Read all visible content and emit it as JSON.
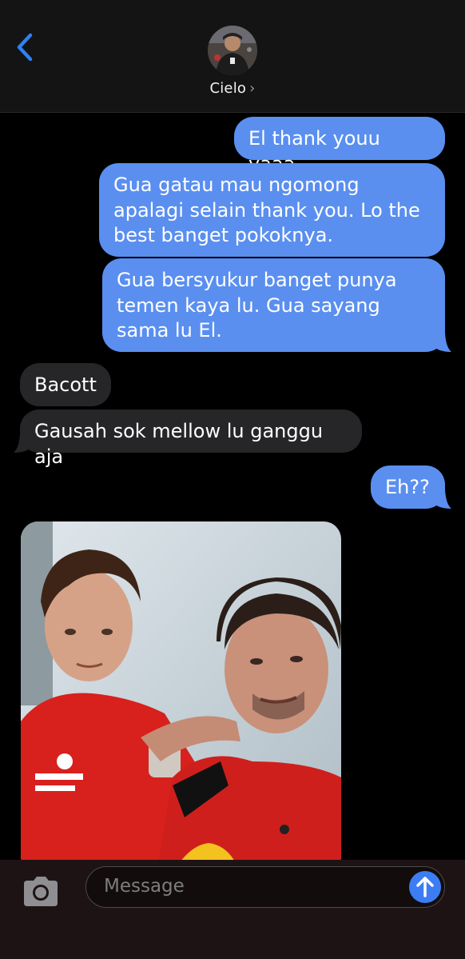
{
  "header": {
    "contact_name": "Cielo",
    "contact_chevron": "›",
    "back_icon": "chevron-left-icon",
    "accent": "#2f80f4"
  },
  "messages": [
    {
      "side": "out",
      "text": "El thank youu yaaa"
    },
    {
      "side": "out",
      "text": "Gua gatau mau ngomong apalagi selain thank you. Lo the best banget pokoknya."
    },
    {
      "side": "out",
      "text": "Gua bersyukur banget punya temen kaya lu. Gua sayang sama lu El."
    },
    {
      "side": "in",
      "text": "Bacott"
    },
    {
      "side": "in",
      "text": "Gausah sok mellow lu ganggu aja"
    },
    {
      "side": "out",
      "text": "Eh??"
    },
    {
      "side": "in",
      "type": "photo"
    }
  ],
  "composer": {
    "placeholder": "Message",
    "camera_icon": "camera-icon",
    "send_icon": "arrow-up-icon"
  },
  "colors": {
    "outgoing_bubble": "#5a8ff0",
    "incoming_bubble": "#262628",
    "send_button": "#3d7df4"
  }
}
